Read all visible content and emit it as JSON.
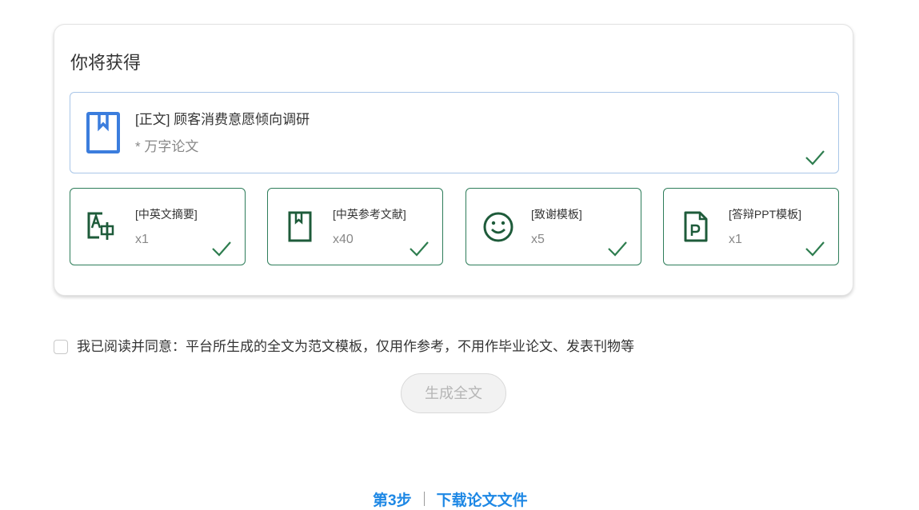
{
  "card": {
    "title": "你将获得",
    "main_item": {
      "name": "[正文] 顾客消费意愿倾向调研",
      "subtitle": "* 万字论文",
      "icon": "bookmark-book-icon",
      "checked": true
    },
    "items": [
      {
        "name": "[中英文摘要]",
        "count": "x1",
        "icon": "translate-icon",
        "checked": true
      },
      {
        "name": "[中英参考文献]",
        "count": "x40",
        "icon": "book-icon",
        "checked": true
      },
      {
        "name": "[致谢模板]",
        "count": "x5",
        "icon": "smiley-icon",
        "checked": true
      },
      {
        "name": "[答辩PPT模板]",
        "count": "x1",
        "icon": "ppt-file-icon",
        "checked": true
      }
    ]
  },
  "agreement": {
    "checked": false,
    "text": "我已阅读并同意：平台所生成的全文为范文模板，仅用作参考，不用作毕业论文、发表刊物等"
  },
  "generate_button": {
    "label": "生成全文",
    "disabled": true
  },
  "next_step": {
    "step_label": "第3步",
    "action_label": "下载论文文件"
  },
  "colors": {
    "main_border": "#a9c6e8",
    "item_border": "#2e7d5a",
    "icon_blue": "#3b7ddd",
    "icon_green": "#1e5b3a",
    "check_green": "#2e7d4f",
    "step_blue": "#1e88e5"
  }
}
